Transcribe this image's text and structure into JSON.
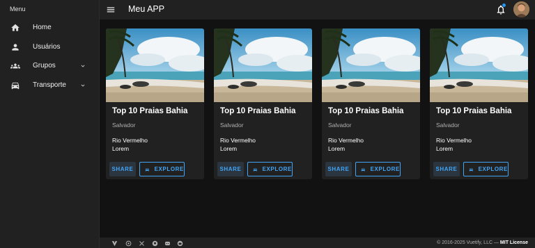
{
  "sidebar": {
    "header": "Menu",
    "items": [
      {
        "label": "Home",
        "icon": "home-icon"
      },
      {
        "label": "Usuários",
        "icon": "person-icon"
      },
      {
        "label": "Grupos",
        "icon": "group-icon",
        "expandable": true
      },
      {
        "label": "Transporte",
        "icon": "car-icon",
        "expandable": true
      }
    ]
  },
  "topbar": {
    "title": "Meu APP",
    "notification_badge_color": "#2196f3"
  },
  "cards": [
    {
      "title": "Top 10 Praias Bahia",
      "subtitle": "Salvador",
      "text1": "Rio Vermelho",
      "text2": "Lorem",
      "share_label": "SHARE",
      "explore_label": "EXPLORE"
    },
    {
      "title": "Top 10 Praias Bahia",
      "subtitle": "Salvador",
      "text1": "Rio Vermelho",
      "text2": "Lorem",
      "share_label": "SHARE",
      "explore_label": "EXPLORE"
    },
    {
      "title": "Top 10 Praias Bahia",
      "subtitle": "Salvador",
      "text1": "Rio Vermelho",
      "text2": "Lorem",
      "share_label": "SHARE",
      "explore_label": "EXPLORE"
    },
    {
      "title": "Top 10 Praias Bahia",
      "subtitle": "Salvador",
      "text1": "Rio Vermelho",
      "text2": "Lorem",
      "share_label": "SHARE",
      "explore_label": "EXPLORE"
    }
  ],
  "footer": {
    "copyright": "© 2016-2025 Vuetify, LLC —",
    "license": "MIT License",
    "icons": [
      "vuetify-logo-icon",
      "shield-icon",
      "x-icon",
      "github-icon",
      "discord-icon",
      "reddit-icon"
    ]
  },
  "colors": {
    "accent": "#42a5f5",
    "surface": "#212121",
    "background": "#121212"
  }
}
